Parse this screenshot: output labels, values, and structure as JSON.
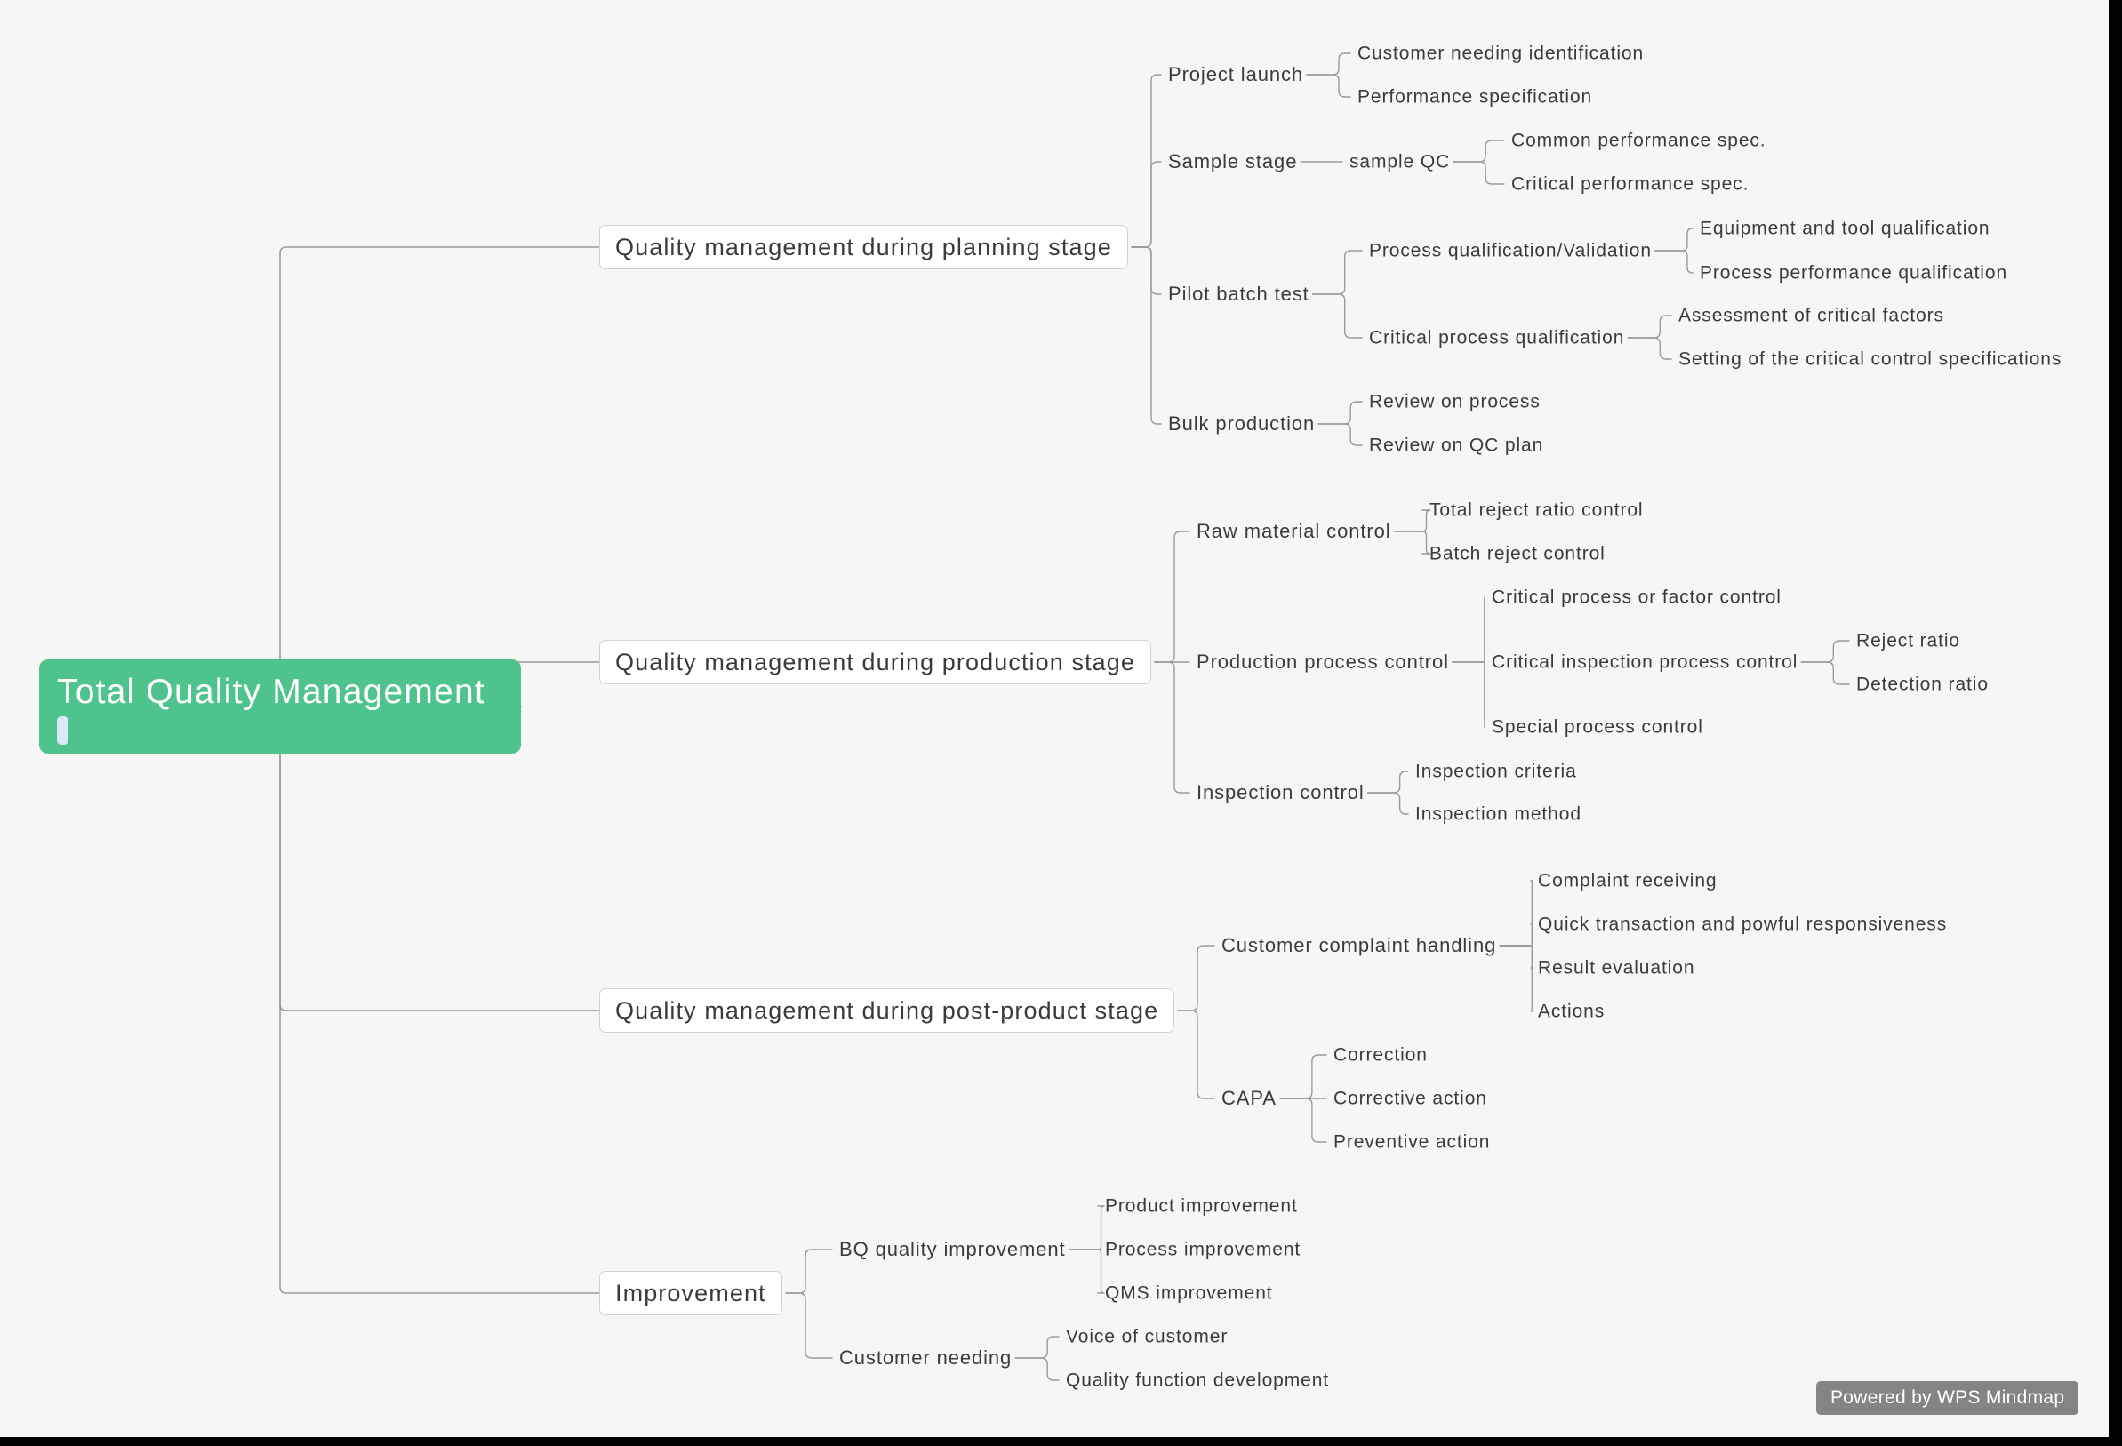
{
  "app": {
    "type": "mindmap",
    "background_color": "#f6f6f6",
    "root_color": "#4ec48c",
    "node_border_color": "#d2d2d2",
    "edge_color": "#9a9a9a",
    "text_color": "#3b3b3b",
    "caret_color": "#d7eaf6"
  },
  "watermark": {
    "label": "Powered by WPS Mindmap",
    "background_color": "#848484",
    "text_color": "#ffffff"
  },
  "root": {
    "label": "Total Quality Management",
    "has_caret": true
  },
  "branches": [
    {
      "label": "Quality management during planning stage",
      "children": [
        {
          "label": "Project launch",
          "children": [
            {
              "label": "Customer needing identification"
            },
            {
              "label": "Performance specification"
            }
          ]
        },
        {
          "label": "Sample stage",
          "children": [
            {
              "label": "sample QC",
              "children": [
                {
                  "label": "Common performance spec."
                },
                {
                  "label": "Critical performance spec."
                }
              ]
            }
          ]
        },
        {
          "label": "Pilot batch test",
          "children": [
            {
              "label": "Process qualification/Validation",
              "children": [
                {
                  "label": "Equipment and tool qualification"
                },
                {
                  "label": "Process performance qualification"
                }
              ]
            },
            {
              "label": "Critical process qualification",
              "children": [
                {
                  "label": "Assessment of critical factors"
                },
                {
                  "label": "Setting of the critical control specifications"
                }
              ]
            }
          ]
        },
        {
          "label": "Bulk production",
          "children": [
            {
              "label": "Review on process"
            },
            {
              "label": "Review on QC plan"
            }
          ]
        }
      ]
    },
    {
      "label": "Quality management during production stage",
      "children": [
        {
          "label": "Raw material control",
          "children": [
            {
              "label": "Total reject ratio control"
            },
            {
              "label": "Batch reject control"
            }
          ]
        },
        {
          "label": "Production process control",
          "children": [
            {
              "label": "Critical process or factor control"
            },
            {
              "label": "Critical inspection process control",
              "children": [
                {
                  "label": "Reject ratio"
                },
                {
                  "label": "Detection ratio"
                }
              ]
            },
            {
              "label": "Special process control"
            }
          ]
        },
        {
          "label": "Inspection control",
          "children": [
            {
              "label": "Inspection criteria"
            },
            {
              "label": "Inspection method"
            }
          ]
        }
      ]
    },
    {
      "label": "Quality management during post-product stage",
      "children": [
        {
          "label": "Customer complaint handling",
          "children": [
            {
              "label": "Complaint receiving"
            },
            {
              "label": "Quick transaction and powful responsiveness"
            },
            {
              "label": "Result evaluation"
            },
            {
              "label": "Actions"
            }
          ]
        },
        {
          "label": "CAPA",
          "children": [
            {
              "label": "Correction"
            },
            {
              "label": "Corrective action"
            },
            {
              "label": "Preventive action"
            }
          ]
        }
      ]
    },
    {
      "label": "Improvement",
      "children": [
        {
          "label": "BQ quality improvement",
          "children": [
            {
              "label": "Product improvement"
            },
            {
              "label": "Process improvement"
            },
            {
              "label": "QMS improvement"
            }
          ]
        },
        {
          "label": "Customer needing",
          "children": [
            {
              "label": "Voice of customer"
            },
            {
              "label": "Quality function development"
            }
          ]
        }
      ]
    }
  ]
}
